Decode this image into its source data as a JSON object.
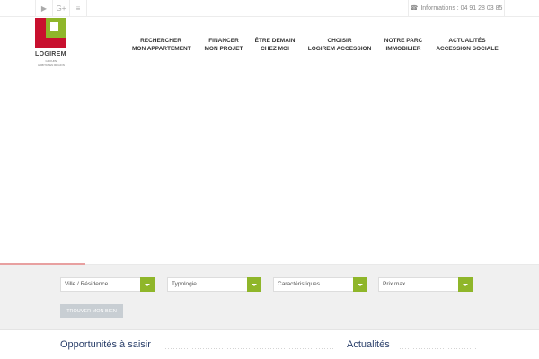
{
  "topbar": {
    "social": [
      {
        "icon": "youtube-icon",
        "glyph": "▶"
      },
      {
        "icon": "google-plus-icon",
        "glyph": "G+"
      },
      {
        "icon": "rss-icon",
        "glyph": "≡"
      }
    ],
    "info": {
      "icon": "phone-icon",
      "glyph": "☎",
      "text": "Informations : 04 91 28 03 85"
    }
  },
  "logo": {
    "name": "LOGIREM",
    "sub_line1": "GROUPE",
    "sub_line2": "HABITAT EN RÉGION",
    "colors": {
      "red": "#c8102e",
      "green": "#8fb62a"
    }
  },
  "nav": [
    {
      "line1": "RECHERCHER",
      "line2": "MON APPARTEMENT"
    },
    {
      "line1": "FINANCER",
      "line2": "MON PROJET"
    },
    {
      "line1": "ÊTRE DEMAIN",
      "line2": "CHEZ MOI"
    },
    {
      "line1": "CHOISIR",
      "line2": "LOGIREM ACCESSION"
    },
    {
      "line1": "NOTRE PARC",
      "line2": "IMMOBILIER"
    },
    {
      "line1": "ACTUALITÉS",
      "line2": "ACCESSION SOCIALE"
    }
  ],
  "search": {
    "selects": [
      {
        "label": "Ville / Résidence"
      },
      {
        "label": "Typologie"
      },
      {
        "label": "Caractéristiques"
      },
      {
        "label": "Prix max."
      }
    ],
    "button_label": "TROUVER MON BIEN"
  },
  "sections": {
    "left_title": "Opportunités à saisir",
    "right_title": "Actualités"
  }
}
